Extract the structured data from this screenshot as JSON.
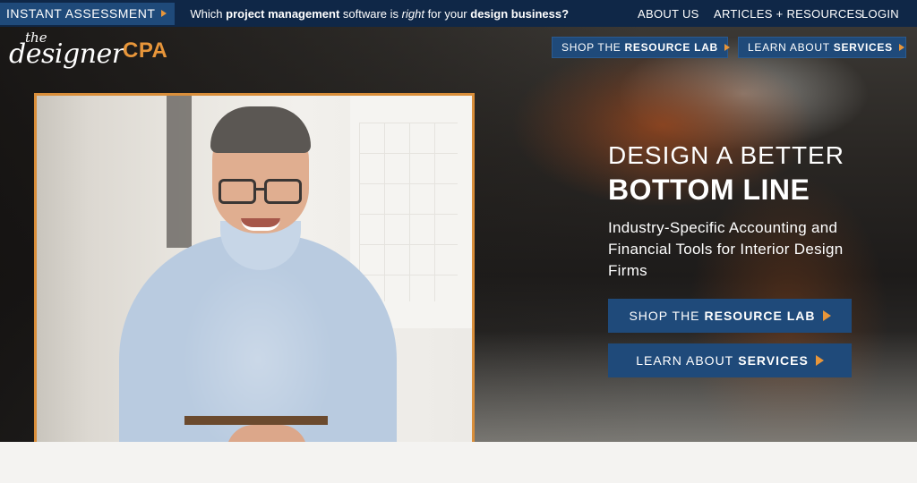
{
  "topbar": {
    "assessment_label": "INSTANT ASSESSMENT",
    "promo": {
      "part1": "Which ",
      "bold1": "project management",
      "part2": " software is ",
      "italic1": "right",
      "part3": " for your ",
      "bold2": "design business?"
    },
    "nav": {
      "about": "ABOUT US",
      "articles": "ARTICLES + RESOURCES",
      "login": "LOGIN"
    }
  },
  "logo": {
    "the": "the",
    "designer": "designer",
    "cpa": "CPA"
  },
  "header_buttons": {
    "shop_prefix": "SHOP THE",
    "shop_bold": "RESOURCE LAB",
    "learn_prefix": "LEARN ABOUT",
    "learn_bold": "SERVICES"
  },
  "hero": {
    "line1": "DESIGN A BETTER",
    "line2": "BOTTOM LINE",
    "subtitle": "Industry-Specific Accounting and Financial Tools for Interior Design Firms",
    "cta_shop_prefix": "SHOP THE",
    "cta_shop_bold": "RESOURCE LAB",
    "cta_learn_prefix": "LEARN ABOUT",
    "cta_learn_bold": "SERVICES"
  },
  "colors": {
    "navy": "#0f2747",
    "button_blue": "#1f4a7a",
    "accent_orange": "#e8963a",
    "frame_orange": "#d98e3a"
  },
  "icons": {
    "arrow": "play-triangle-icon"
  }
}
